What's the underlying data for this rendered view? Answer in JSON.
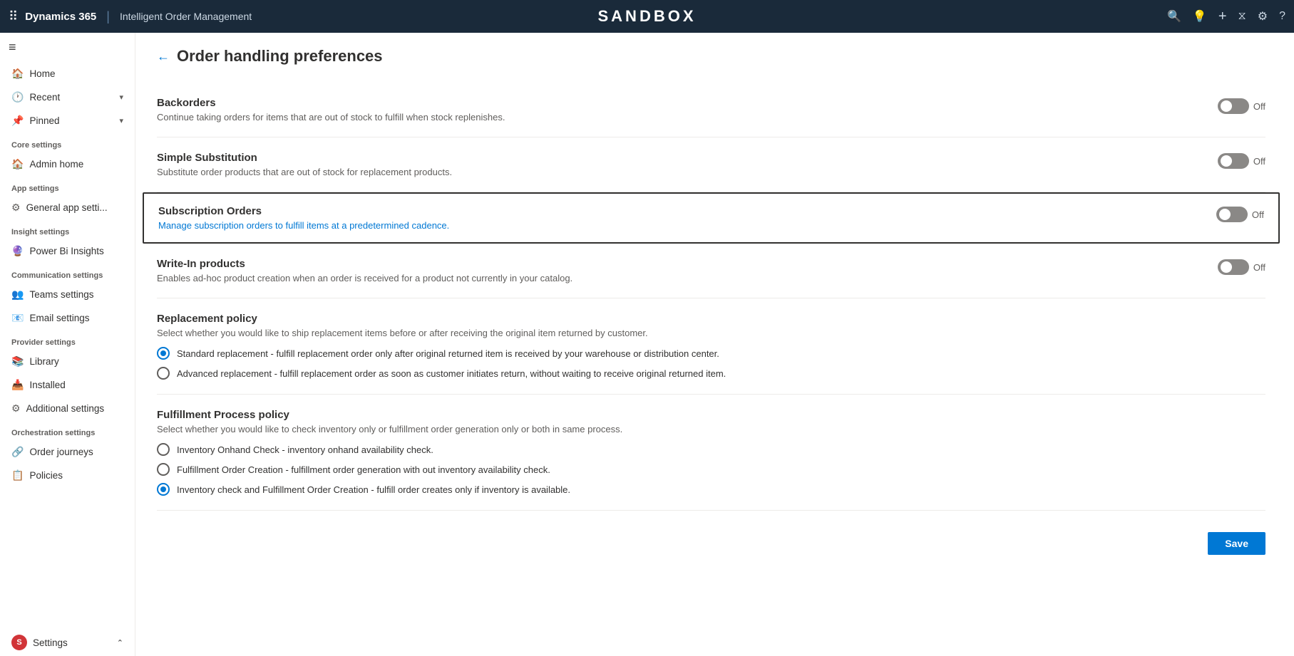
{
  "topbar": {
    "brand": "Dynamics 365",
    "separator": "|",
    "app_name": "Intelligent Order Management",
    "sandbox_label": "SANDBOX",
    "icons": {
      "search": "🔍",
      "lightbulb": "💡",
      "add": "+",
      "filter": "⧖",
      "settings": "⚙",
      "help": "?"
    }
  },
  "sidebar": {
    "hamburger": "≡",
    "nav_items": [
      {
        "label": "Home",
        "icon": "🏠"
      },
      {
        "label": "Recent",
        "icon": "🕐",
        "chevron": "▾"
      },
      {
        "label": "Pinned",
        "icon": "📌",
        "chevron": "▾"
      }
    ],
    "sections": [
      {
        "label": "Core settings",
        "items": [
          {
            "label": "Admin home",
            "icon": "🏠"
          }
        ]
      },
      {
        "label": "App settings",
        "items": [
          {
            "label": "General app setti...",
            "icon": "⚙"
          }
        ]
      },
      {
        "label": "Insight settings",
        "items": [
          {
            "label": "Power Bi Insights",
            "icon": "🔮"
          }
        ]
      },
      {
        "label": "Communication settings",
        "items": [
          {
            "label": "Teams settings",
            "icon": "👥"
          },
          {
            "label": "Email settings",
            "icon": "📧"
          }
        ]
      },
      {
        "label": "Provider settings",
        "items": [
          {
            "label": "Library",
            "icon": "📚"
          },
          {
            "label": "Installed",
            "icon": "📥"
          },
          {
            "label": "Additional settings",
            "icon": "⚙"
          }
        ]
      },
      {
        "label": "Orchestration settings",
        "items": [
          {
            "label": "Order journeys",
            "icon": "🔗"
          },
          {
            "label": "Policies",
            "icon": "📋"
          }
        ]
      }
    ],
    "bottom_item": {
      "label": "Settings",
      "avatar": "S",
      "chevron": "⌃"
    }
  },
  "page": {
    "back_label": "←",
    "title": "Order handling preferences",
    "settings": [
      {
        "id": "backorders",
        "name": "Backorders",
        "desc": "Continue taking orders for items that are out of stock to fulfill when stock replenishes.",
        "toggle_state": "Off",
        "highlighted": false
      },
      {
        "id": "simple-substitution",
        "name": "Simple Substitution",
        "desc": "Substitute order products that are out of stock for replacement products.",
        "toggle_state": "Off",
        "highlighted": false
      },
      {
        "id": "subscription-orders",
        "name": "Subscription Orders",
        "desc": "Manage subscription orders to fulfill items at a predetermined cadence.",
        "toggle_state": "Off",
        "highlighted": true
      },
      {
        "id": "write-in-products",
        "name": "Write-In products",
        "desc": "Enables ad-hoc product creation when an order is received for a product not currently in your catalog.",
        "toggle_state": "Off",
        "highlighted": false
      }
    ],
    "replacement_policy": {
      "label": "Replacement policy",
      "desc": "Select whether you would like to ship replacement items before or after receiving the original item returned by customer.",
      "options": [
        {
          "id": "standard",
          "label": "Standard replacement - fulfill replacement order only after original returned item is received by your warehouse or distribution center.",
          "selected": true
        },
        {
          "id": "advanced",
          "label": "Advanced replacement - fulfill replacement order as soon as customer initiates return, without waiting to receive original returned item.",
          "selected": false
        }
      ]
    },
    "fulfillment_policy": {
      "label": "Fulfillment Process policy",
      "desc": "Select whether you would like to check inventory only or fulfillment order generation only or both in same process.",
      "options": [
        {
          "id": "inventory-onhand",
          "label": "Inventory Onhand Check - inventory onhand availability check.",
          "selected": false
        },
        {
          "id": "fulfillment-creation",
          "label": "Fulfillment Order Creation - fulfillment order generation with out inventory availability check.",
          "selected": false
        },
        {
          "id": "inventory-fulfillment",
          "label": "Inventory check and Fulfillment Order Creation - fulfill order creates only if inventory is available.",
          "selected": true
        }
      ]
    },
    "save_button": "Save"
  }
}
